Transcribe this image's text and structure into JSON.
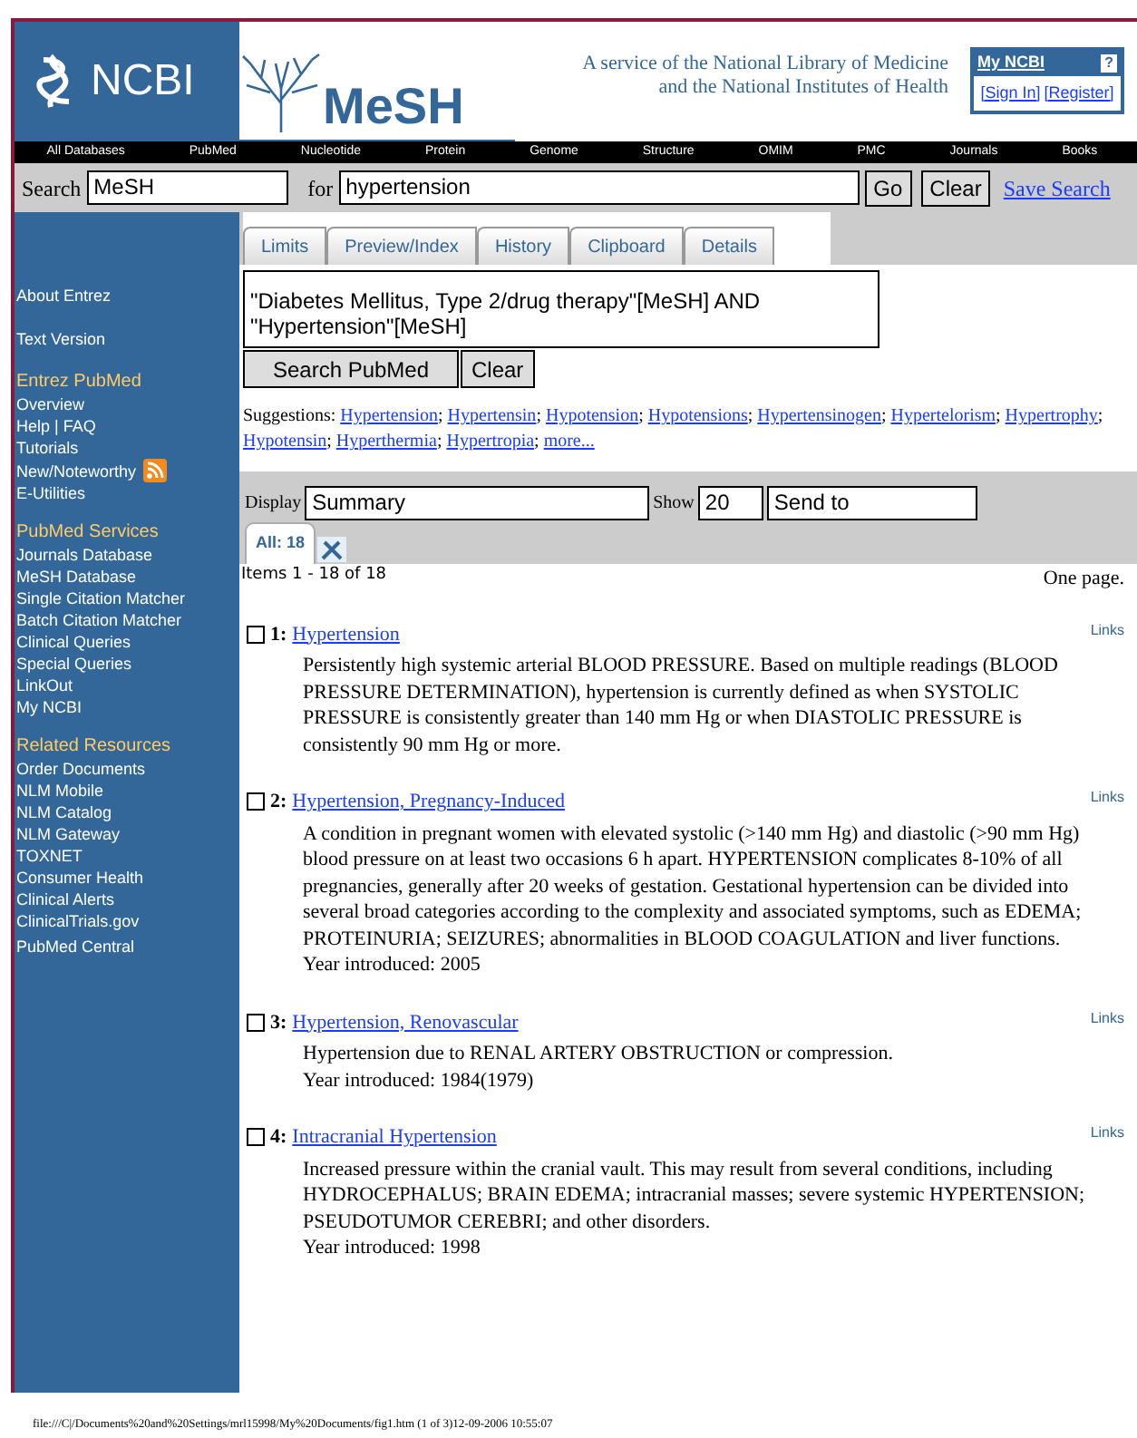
{
  "header": {
    "ncbi_logo": "NCBI",
    "mesh_logo": "MeSH",
    "service_lines": [
      "A service of the National Library of Medicine",
      "and the National Institutes of Health"
    ],
    "my_ncbi": {
      "title": "My NCBI",
      "help": "?",
      "sign_in": "[Sign In]",
      "register": "[Register]"
    }
  },
  "nav": [
    "All Databases",
    "PubMed",
    "Nucleotide",
    "Protein",
    "Genome",
    "Structure",
    "OMIM",
    "PMC",
    "Journals",
    "Books"
  ],
  "search": {
    "label": "Search",
    "database": "MeSH",
    "for_label": "for",
    "query": "hypertension",
    "buttons": [
      "Go",
      "Clear"
    ],
    "save_link": "Save Search"
  },
  "tabs": [
    {
      "label": "Limits",
      "selected": false
    },
    {
      "label": "Preview/Index",
      "selected": false
    },
    {
      "label": "History",
      "selected": false
    },
    {
      "label": "Clipboard",
      "selected": false
    },
    {
      "label": "Details",
      "selected": false
    }
  ],
  "sidebar": [
    {
      "items": [
        {
          "label": "About Entrez",
          "kind": "spaced"
        },
        {
          "label": "Text Version",
          "kind": "spaced"
        }
      ]
    },
    {
      "title": "Entrez PubMed",
      "items": [
        {
          "label": "Overview",
          "kind": "link"
        },
        {
          "label": "Help | FAQ",
          "kind": "link"
        },
        {
          "label": "Tutorials",
          "kind": "link"
        },
        {
          "label": "New/Noteworthy",
          "kind": "rss"
        },
        {
          "label": "E-Utilities",
          "kind": "link"
        }
      ]
    },
    {
      "title": "PubMed Services",
      "items": [
        {
          "label": "Journals Database",
          "kind": "link"
        },
        {
          "label": "MeSH Database",
          "kind": "link"
        },
        {
          "label": "Single Citation Matcher",
          "kind": "link"
        },
        {
          "label": "Batch Citation Matcher",
          "kind": "link"
        },
        {
          "label": "Clinical Queries",
          "kind": "link"
        },
        {
          "label": "Special Queries",
          "kind": "link"
        },
        {
          "label": "LinkOut",
          "kind": "link"
        },
        {
          "label": "My NCBI",
          "kind": "link"
        }
      ]
    },
    {
      "title": "Related Resources",
      "items": [
        {
          "label": "Order Documents",
          "kind": "link"
        },
        {
          "label": "NLM Mobile",
          "kind": "link"
        },
        {
          "label": "NLM Catalog",
          "kind": "link"
        },
        {
          "label": "NLM Gateway",
          "kind": "link"
        },
        {
          "label": "TOXNET",
          "kind": "link"
        },
        {
          "label": "Consumer Health",
          "kind": "link"
        },
        {
          "label": "Clinical Alerts",
          "kind": "link"
        },
        {
          "label": "ClinicalTrials.gov",
          "kind": "link"
        },
        {
          "label": "PubMed Central",
          "kind": "spaced"
        }
      ]
    }
  ],
  "query_box": "\"Diabetes Mellitus, Type 2/drug therapy\"[MeSH] AND \"Hypertension\"[MeSH]",
  "query_buttons": [
    "Search PubMed",
    "Clear"
  ],
  "suggestions": {
    "label": "Suggestions:",
    "separator": ";",
    "links": [
      "Hypertension",
      "Hypertensin",
      "Hypotension",
      "Hypotensions",
      "Hypertensinogen",
      "Hypertelorism",
      "Hypertrophy",
      "Hypotensin",
      "Hyperthermia",
      "Hypertropia",
      "more..."
    ]
  },
  "display_bar": {
    "display_label": "Display",
    "display_value": "Summary",
    "show_label": "Show",
    "show_value": "20",
    "send_to": "Send to"
  },
  "result_tabs": [
    {
      "label": "All: 18",
      "selected": true
    }
  ],
  "items_text": "Items 1 - 18 of 18",
  "page_text": "One page.",
  "results": [
    {
      "number": "1:",
      "title": "Hypertension",
      "checked": false,
      "links": "Links",
      "lines": [
        "Persistently high systemic arterial BLOOD PRESSURE. Based on multiple readings (BLOOD PRESSURE DETERMINATION), hypertension is currently defined as when SYSTOLIC PRESSURE is consistently greater than 140 mm Hg or when DIASTOLIC PRESSURE is consistently 90 mm Hg or more."
      ]
    },
    {
      "number": "2:",
      "title": "Hypertension, Pregnancy-Induced",
      "checked": false,
      "links": "Links",
      "lines": [
        "A condition in pregnant women with elevated systolic (>140 mm Hg) and diastolic (>90 mm Hg) blood pressure on at least two occasions 6 h apart. HYPERTENSION complicates 8-10% of all pregnancies, generally after 20 weeks of gestation. Gestational hypertension can be divided into several broad categories according to the complexity and associated symptoms, such as EDEMA; PROTEINURIA; SEIZURES; abnormalities in BLOOD COAGULATION and liver functions.",
        "Year introduced: 2005"
      ]
    },
    {
      "number": "3:",
      "title": "Hypertension, Renovascular",
      "checked": false,
      "links": "Links",
      "lines": [
        "Hypertension due to RENAL ARTERY OBSTRUCTION or compression.",
        "Year introduced: 1984(1979)"
      ]
    },
    {
      "number": "4:",
      "title": "Intracranial Hypertension",
      "checked": false,
      "links": "Links",
      "lines": [
        "Increased pressure within the cranial vault. This may result from several conditions, including HYDROCEPHALUS; BRAIN EDEMA; intracranial masses; severe systemic HYPERTENSION; PSEUDOTUMOR CEREBRI; and other disorders.",
        "Year introduced: 1998"
      ]
    }
  ],
  "footer": "file:///C|/Documents%20and%20Settings/mrl15998/My%20Documents/fig1.htm (1 of 3)12-09-2006 10:55:07"
}
